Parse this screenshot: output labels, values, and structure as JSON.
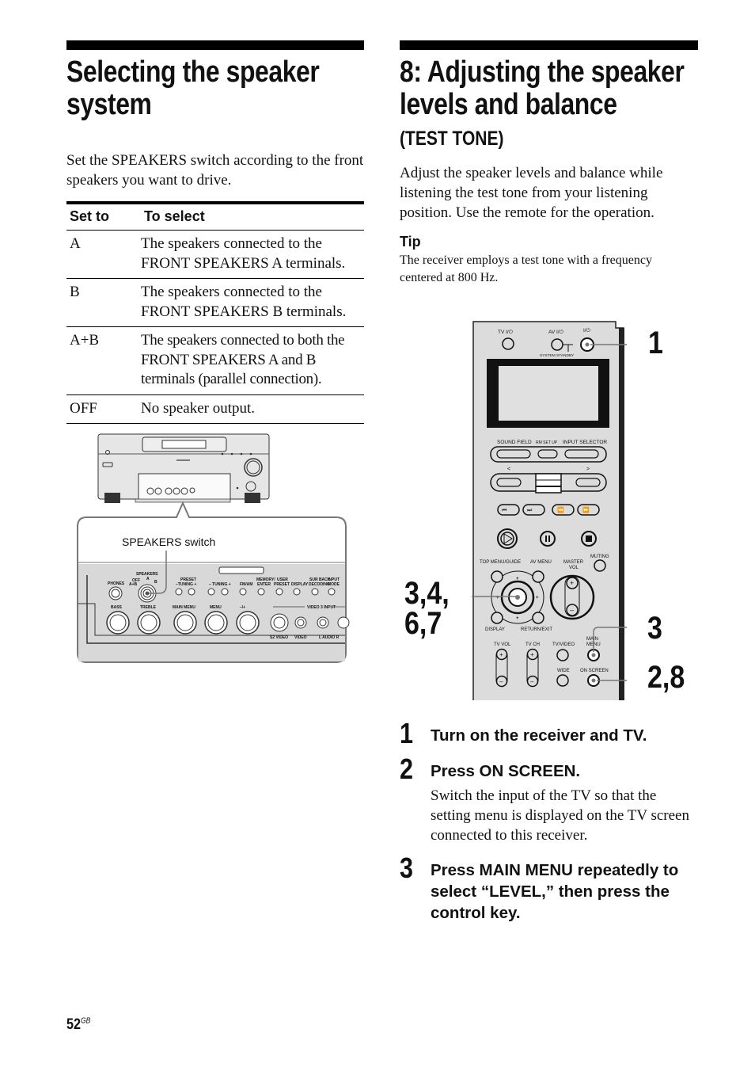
{
  "left_section": {
    "title_line1": "Selecting the speaker",
    "title_line2": "system",
    "intro": "Set the SPEAKERS switch according to the front speakers you want to drive.",
    "table": {
      "headers": [
        "Set to",
        "To select"
      ],
      "rows": [
        {
          "set_to": "A",
          "to_select": "The speakers connected to the FRONT SPEAKERS A terminals."
        },
        {
          "set_to": "B",
          "to_select": "The speakers connected to the FRONT SPEAKERS B terminals."
        },
        {
          "set_to": "A+B",
          "to_select": "The speakers connected to both the FRONT SPEAKERS A and B terminals (parallel connection)."
        },
        {
          "set_to": "OFF",
          "to_select": "No speaker output."
        }
      ]
    },
    "illustration": {
      "callout_label": "SPEAKERS switch",
      "panel_labels": {
        "speakers": "SPEAKERS",
        "off": "OFF",
        "a": "A",
        "b": "B",
        "ab": "A+B",
        "phones": "PHONES",
        "preset": "PRESET",
        "preset_tuning": "–TUNING +",
        "tuning": "– TUNING +",
        "fmam": "FM/AM",
        "memory": "MEMORY/",
        "enter": "ENTER",
        "user": "USER",
        "preset2": "PRESET",
        "display": "DISPLAY",
        "surr_back": "SUR BACK",
        "decoding": "DECODING",
        "input": "INPUT",
        "mode": "MODE",
        "bass": "BASS",
        "treble": "TREBLE",
        "main_menu": "MAIN MENU",
        "menu": "MENU",
        "minus_plus": "–/+",
        "video3_input": "VIDEO 3 INPUT",
        "s2video": "S2 VIDEO",
        "video": "VIDEO",
        "audio": "L  AUDIO  R"
      }
    }
  },
  "right_section": {
    "title_line1": "8: Adjusting the speaker",
    "title_line2": "levels and balance",
    "subtitle": "(TEST TONE)",
    "intro": "Adjust the speaker levels and balance while listening the test tone from your listening position. Use the remote for the operation.",
    "tip_title": "Tip",
    "tip_text": "The receiver employs a test tone with a frequency centered at 800 Hz.",
    "remote": {
      "labels": {
        "tv_power": "TV I/⏻",
        "av_power": "AV I/⏻",
        "power": "I/⏻",
        "system_standby": "SYSTEM STANDBY",
        "sound_field": "SOUND FIELD",
        "rm_setup": "RM SET UP",
        "input_selector": "INPUT SELECTOR",
        "left_arrow": "<",
        "right_arrow": ">",
        "top_menu": "TOP MENU/GUIDE",
        "av_menu": "AV MENU",
        "master_vol": "MASTER",
        "vol": "VOL",
        "muting": "MUTING",
        "display": "DISPLAY",
        "return_exit": "RETURN/EXIT",
        "tv_vol": "TV VOL",
        "tv_ch": "TV CH",
        "tv_video": "TV/VIDEO",
        "main_menu_1": "MAIN",
        "main_menu_2": "MENU",
        "wide": "WIDE",
        "on_screen": "ON SCREEN",
        "plus": "+",
        "minus": "–"
      },
      "callouts": {
        "power": "1",
        "control_1": "3,4,",
        "control_2": "6,7",
        "main_menu": "3",
        "on_screen": "2,8"
      }
    },
    "steps": [
      {
        "number": "1",
        "title": "Turn on the receiver and TV.",
        "body": ""
      },
      {
        "number": "2",
        "title": "Press ON SCREEN.",
        "body": "Switch the input of the TV so that the setting menu is displayed on the TV screen connected to this receiver."
      },
      {
        "number": "3",
        "title": "Press MAIN MENU repeatedly to select “LEVEL,” then press the control key.",
        "body": ""
      }
    ]
  },
  "footer": {
    "page_number": "52",
    "region": "GB"
  }
}
